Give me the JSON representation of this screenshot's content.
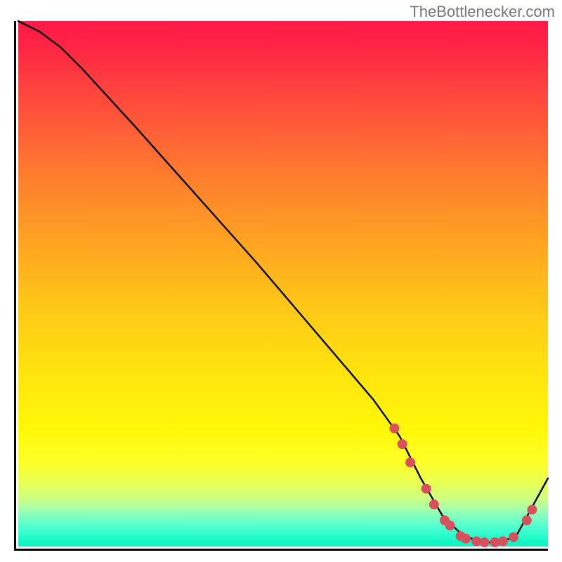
{
  "attribution": "TheBottlenecker.com",
  "chart_data": {
    "type": "line",
    "title": "",
    "xlabel": "",
    "ylabel": "",
    "xlim": [
      0,
      100
    ],
    "ylim": [
      0,
      100
    ],
    "series": [
      {
        "name": "curve",
        "x": [
          0,
          4,
          8,
          12,
          22,
          45,
          67,
          72,
          76,
          80,
          84,
          88,
          91,
          94,
          100
        ],
        "values": [
          100,
          98,
          95,
          91,
          80,
          54,
          28,
          21,
          13,
          6,
          2,
          0.8,
          0.8,
          2,
          13
        ]
      }
    ],
    "markers": {
      "color": "#d94f5c",
      "radius_px": 7,
      "points_xy": [
        [
          71,
          22.5
        ],
        [
          72.5,
          19.5
        ],
        [
          74,
          16
        ],
        [
          77,
          11
        ],
        [
          78.5,
          8
        ],
        [
          80.5,
          5
        ],
        [
          81.5,
          4
        ],
        [
          83.5,
          2
        ],
        [
          84.5,
          1.5
        ],
        [
          86.5,
          1
        ],
        [
          88,
          0.8
        ],
        [
          90,
          0.8
        ],
        [
          91.5,
          1
        ],
        [
          93.5,
          1.8
        ],
        [
          96,
          5
        ],
        [
          97,
          7
        ]
      ]
    },
    "background_gradient": {
      "direction": "vertical",
      "stops": [
        {
          "pos": 0.0,
          "color": "#ff1a47"
        },
        {
          "pos": 0.5,
          "color": "#ffc917"
        },
        {
          "pos": 0.8,
          "color": "#fcff28"
        },
        {
          "pos": 0.93,
          "color": "#a3ffb0"
        },
        {
          "pos": 1.0,
          "color": "#0ef4c2"
        }
      ]
    }
  }
}
